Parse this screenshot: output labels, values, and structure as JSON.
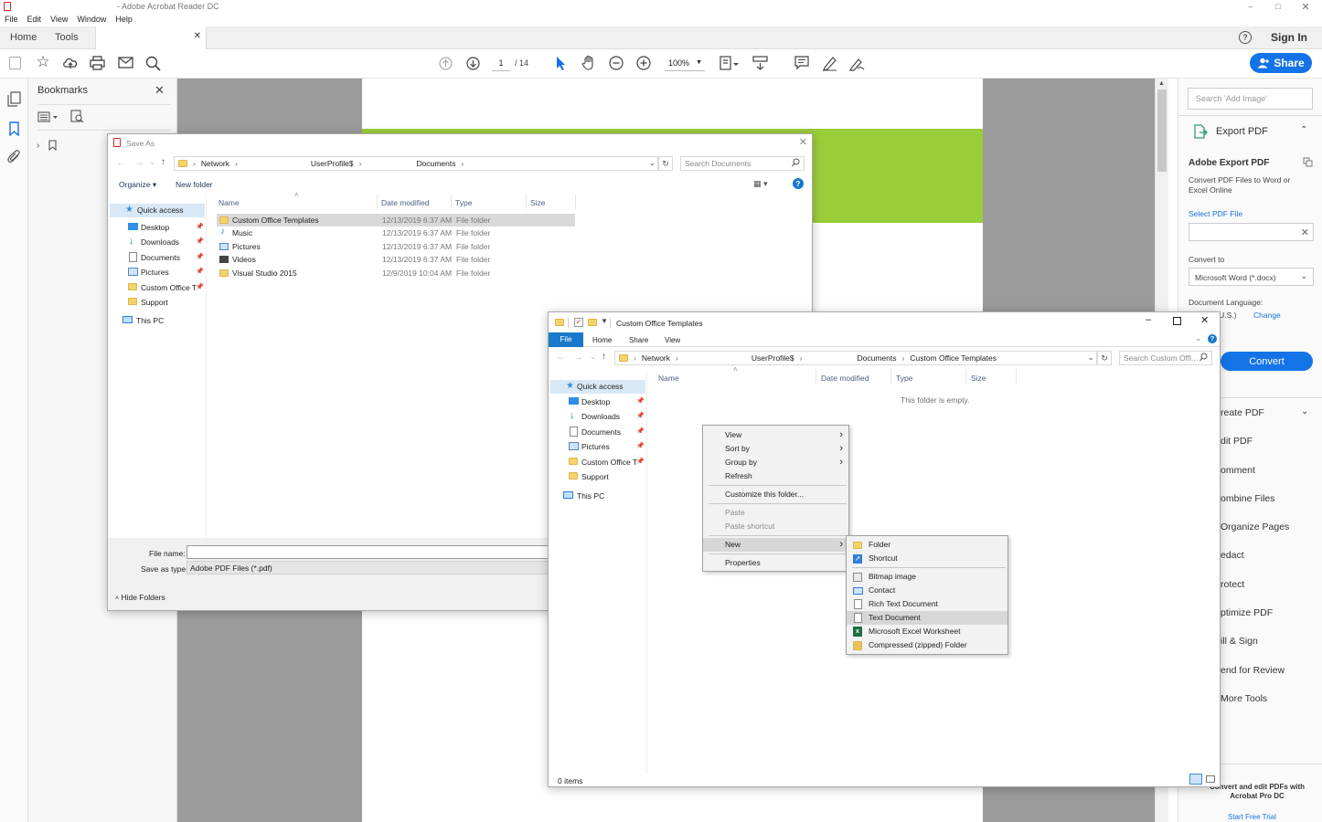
{
  "app": {
    "title": "- Adobe Acrobat Reader DC",
    "menu": [
      "File",
      "Edit",
      "View",
      "Window",
      "Help"
    ],
    "tabs": {
      "home": "Home",
      "tools": "Tools"
    },
    "sign_in": "Sign In",
    "share": "Share",
    "page_current": "1",
    "page_total": "/ 14",
    "zoom": "100%"
  },
  "bookmarks": {
    "title": "Bookmarks"
  },
  "right_panel": {
    "search_placeholder": "Search 'Add Image'",
    "export_title": "Export PDF",
    "adobe_export_title": "Adobe Export PDF",
    "adobe_export_desc": "Convert PDF Files to Word or Excel Online",
    "select_file": "Select PDF File",
    "convert_to": "Convert to",
    "convert_format": "Microsoft Word (*.docx)",
    "doc_language": "Document Language:",
    "language_value": "English (U.S.)",
    "change": "Change",
    "convert_button": "Convert",
    "tools": [
      "reate PDF",
      "dit PDF",
      "omment",
      "ombine Files",
      "Organize Pages",
      "edact",
      "rotect",
      "ptimize PDF",
      "ill & Sign",
      "end for Review",
      "More Tools"
    ],
    "promo": "Convert and edit PDFs with Acrobat Pro DC",
    "trial": "Start Free Trial"
  },
  "save_as": {
    "title": "Save As",
    "path": [
      "Network",
      "UserProfile$",
      "Documents"
    ],
    "search_placeholder": "Search Documents",
    "organize": "Organize",
    "new_folder": "New folder",
    "columns": {
      "name": "Name",
      "date": "Date modified",
      "type": "Type",
      "size": "Size"
    },
    "nav": {
      "quick_access": "Quick access",
      "items": [
        "Desktop",
        "Downloads",
        "Documents",
        "Pictures",
        "Custom Office T",
        "Support"
      ],
      "this_pc": "This PC"
    },
    "files": [
      {
        "name": "Custom Office Templates",
        "date": "12/13/2019 6:37 AM",
        "type": "File folder"
      },
      {
        "name": "Music",
        "date": "12/13/2019 6:37 AM",
        "type": "File folder"
      },
      {
        "name": "Pictures",
        "date": "12/13/2019 6:37 AM",
        "type": "File folder"
      },
      {
        "name": "Videos",
        "date": "12/13/2019 6:37 AM",
        "type": "File folder"
      },
      {
        "name": "Visual Studio 2015",
        "date": "12/9/2019 10:04 AM",
        "type": "File folder"
      }
    ],
    "file_name_label": "File name:",
    "save_type_label": "Save as type:",
    "save_type_value": "Adobe PDF Files (*.pdf)",
    "hide_folders": "Hide Folders"
  },
  "explorer": {
    "title": "Custom Office Templates",
    "ribbon_tabs": [
      "File",
      "Home",
      "Share",
      "View"
    ],
    "path": [
      "Network",
      "UserProfile$",
      "Documents",
      "Custom Office Templates"
    ],
    "search_placeholder": "Search Custom Offi...",
    "columns": {
      "name": "Name",
      "date": "Date modified",
      "type": "Type",
      "size": "Size"
    },
    "nav": {
      "quick_access": "Quick access",
      "items": [
        "Desktop",
        "Downloads",
        "Documents",
        "Pictures",
        "Custom Office T",
        "Support"
      ],
      "this_pc": "This PC"
    },
    "empty": "This folder is empty.",
    "status": "0 items"
  },
  "context_menu": {
    "view": "View",
    "sort_by": "Sort by",
    "group_by": "Group by",
    "refresh": "Refresh",
    "customize": "Customize this folder...",
    "paste": "Paste",
    "paste_shortcut": "Paste shortcut",
    "new": "New",
    "properties": "Properties"
  },
  "submenu": {
    "folder": "Folder",
    "shortcut": "Shortcut",
    "bitmap": "Bitmap image",
    "contact": "Contact",
    "rtf": "Rich Text Document",
    "text": "Text Document",
    "excel": "Microsoft Excel Worksheet",
    "zip": "Compressed (zipped) Folder"
  },
  "colors": {
    "accent": "#1473e6",
    "green": "#9acd3a",
    "explorer_blue": "#1979ca"
  }
}
